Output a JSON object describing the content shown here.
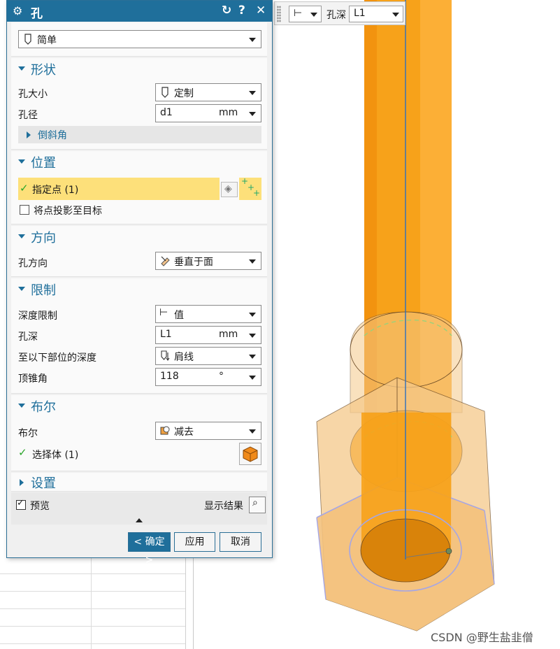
{
  "dialog": {
    "title": "孔",
    "title_icon": "gear-icon",
    "type_select": {
      "value": "简单",
      "icon": "hole-icon"
    }
  },
  "sections": {
    "shape": {
      "title": "形状",
      "hole_size_label": "孔大小",
      "hole_size_value": "定制",
      "diameter_label": "孔径",
      "diameter_value": "d1",
      "diameter_unit": "mm",
      "chamfer_title": "倒斜角"
    },
    "position": {
      "title": "位置",
      "specify_point_label": "指定点 (1)",
      "project_label": "将点投影至目标"
    },
    "direction": {
      "title": "方向",
      "hole_dir_label": "孔方向",
      "hole_dir_value": "垂直于面"
    },
    "limits": {
      "title": "限制",
      "depth_limit_label": "深度限制",
      "depth_limit_value": "值",
      "depth_label": "孔深",
      "depth_value": "L1",
      "depth_unit": "mm",
      "depth_to_label": "至以下部位的深度",
      "depth_to_value": "肩线",
      "tip_angle_label": "顶锥角",
      "tip_angle_value": "118",
      "tip_angle_unit": "°"
    },
    "boolean": {
      "title": "布尔",
      "boolean_label": "布尔",
      "boolean_value": "减去",
      "select_body_label": "选择体 (1)"
    },
    "settings": {
      "title": "设置"
    }
  },
  "footer": {
    "preview_label": "预览",
    "show_result_label": "显示结果",
    "ok_label": "< 确定 >",
    "apply_label": "应用",
    "cancel_label": "取消"
  },
  "toolbar": {
    "depth_label": "孔深",
    "depth_value": "L1"
  },
  "watermark": "CSDN @野生盐韭僧",
  "colors": {
    "accent": "#1f6f9b",
    "highlight": "#fde07a",
    "cylinder": "#f7a21a",
    "nut": "#f5c98a"
  }
}
